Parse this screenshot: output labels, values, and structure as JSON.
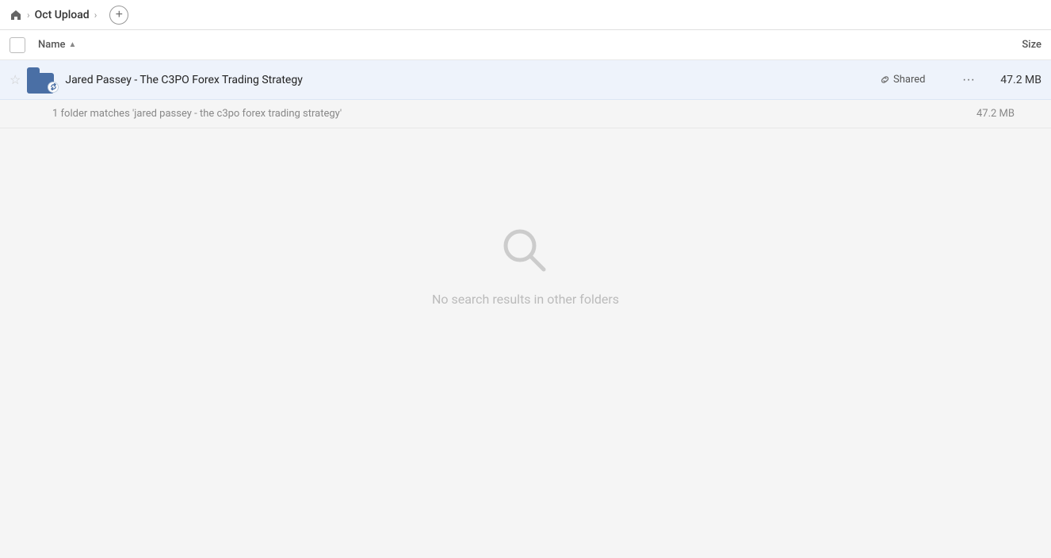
{
  "header": {
    "home_label": "home",
    "breadcrumb": [
      {
        "label": "Oct Upload"
      }
    ],
    "add_button_label": "+"
  },
  "columns": {
    "name_label": "Name",
    "size_label": "Size",
    "sort_direction": "asc"
  },
  "file_row": {
    "name": "Jared Passey - The C3PO Forex Trading Strategy",
    "shared_label": "Shared",
    "size": "47.2 MB",
    "more_label": "···"
  },
  "summary": {
    "text": "1 folder matches 'jared passey - the c3po forex trading strategy'",
    "size": "47.2 MB"
  },
  "empty_state": {
    "message": "No search results in other folders"
  }
}
